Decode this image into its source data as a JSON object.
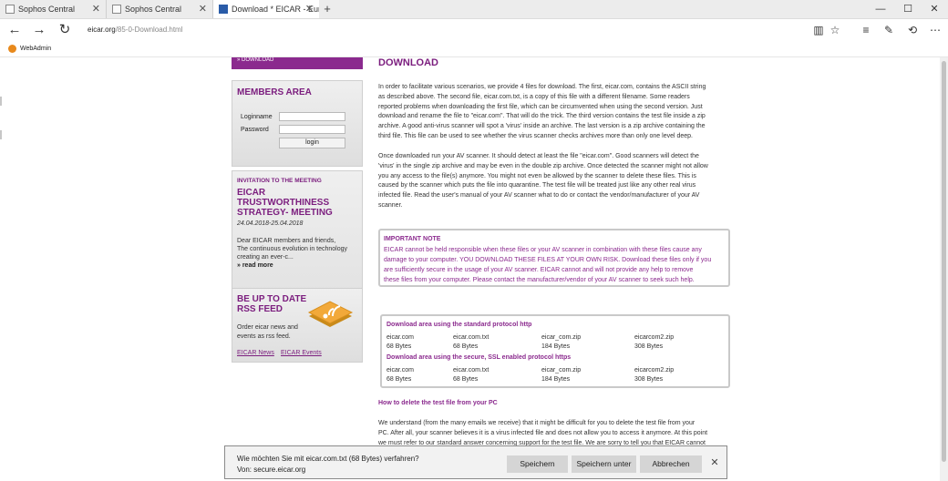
{
  "tabs": [
    {
      "label": "Sophos Central",
      "active": false
    },
    {
      "label": "Sophos Central",
      "active": false
    },
    {
      "label": "Download * EICAR - Eur",
      "active": true
    }
  ],
  "window_controls": [
    "—",
    "☐",
    "✕"
  ],
  "address": {
    "domain": "eicar.org",
    "path": "/85-0-Download.html"
  },
  "favorites": [
    {
      "label": "WebAdmin"
    }
  ],
  "sidebar": {
    "download_link": "» DOWNLOAD",
    "members": {
      "title": "MEMBERS AREA",
      "login_label": "Loginname",
      "password_label": "Password",
      "button": "login"
    },
    "meeting": {
      "kicker": "INVITATION TO THE MEETING",
      "title_lines": [
        "EICAR",
        "TRUSTWORTHINESS",
        "STRATEGY- MEETING"
      ],
      "date": "24.04.2018-25.04.2018",
      "text_lines": [
        "Dear EICAR members and friends,",
        "The continuous evolution in technology",
        "creating an ever-c..."
      ],
      "read_more": "» read more"
    },
    "rss": {
      "title_lines": [
        "BE UP TO DATE",
        "RSS FEED"
      ],
      "text_lines": [
        "Order eicar news and",
        "events as rss feed."
      ],
      "links": [
        "EICAR News",
        "EICAR Events"
      ]
    }
  },
  "main": {
    "heading": "DOWNLOAD",
    "para1": [
      "In order to facilitate various scenarios, we provide 4 files for download. The first, eicar.com, contains the ASCII string",
      "as described above. The second file, eicar.com.txt, is a copy of this file with a different filename. Some readers",
      "reported problems when downloading the first file, which can be circumvented when using the second version. Just",
      "download and rename the file to \"eicar.com\". That will do the trick. The third version contains the test file inside a zip",
      "archive. A good anti-virus scanner will spot a 'virus' inside an archive. The last version is a zip archive containing the",
      "third file. This file can be used to see whether the virus scanner checks archives more than only one level deep."
    ],
    "para2": [
      "Once downloaded run your AV scanner. It should detect at least the file \"eicar.com\". Good scanners will detect the",
      "'virus' in the single zip archive and may be even in the double zip archive. Once detected the scanner might not allow",
      "you any access to the file(s) anymore. You might not even be allowed by the scanner to delete these files. This is",
      "caused by the scanner which puts the file into quarantine. The test file will be treated just like any other real virus",
      "infected file. Read the user's manual of your AV scanner what to do or contact the vendor/manufacturer of your AV",
      "scanner."
    ],
    "note": {
      "title": "IMPORTANT NOTE",
      "lines": [
        "EICAR cannot be held responsible when these files or your AV scanner in combination with these files cause any",
        "damage to your computer. YOU DOWNLOAD THESE FILES AT YOUR OWN RISK.  Download these files only if you",
        "are sufficiently secure in the usage of your AV scanner. EICAR cannot and will not provide any help to remove",
        "these files from your computer. Please contact the manufacturer/vendor of your AV scanner to seek such help."
      ]
    },
    "download_area": {
      "http_title": "Download area using the standard protocol http",
      "https_title": "Download area using the secure, SSL enabled protocol https",
      "files": [
        {
          "name": "eicar.com",
          "size": "68 Bytes"
        },
        {
          "name": "eicar.com.txt",
          "size": "68 Bytes"
        },
        {
          "name": "eicar_com.zip",
          "size": "184 Bytes"
        },
        {
          "name": "eicarcom2.zip",
          "size": "308 Bytes"
        }
      ]
    },
    "delete_heading": "How to delete the test file from your PC",
    "para3": [
      "We understand (from the many emails we receive) that it might be difficult for you to delete the test file from your",
      "PC. After all, your scanner believes it is a virus infected file and does not allow you to access it anymore. At this point",
      "we must refer to our standard answer concerning support for the test file. We are sorry to tell you that EICAR cannot"
    ]
  },
  "download_prompt": {
    "question": "Wie möchten Sie mit eicar.com.txt (68 Bytes) verfahren?",
    "from": "Von: secure.eicar.org",
    "buttons": [
      "Speichern",
      "Speichern unter",
      "Abbrechen"
    ]
  },
  "colors": {
    "accent": "#7b1d7e",
    "accent_bright": "#8b2a8e",
    "rss": "#e8891c"
  }
}
